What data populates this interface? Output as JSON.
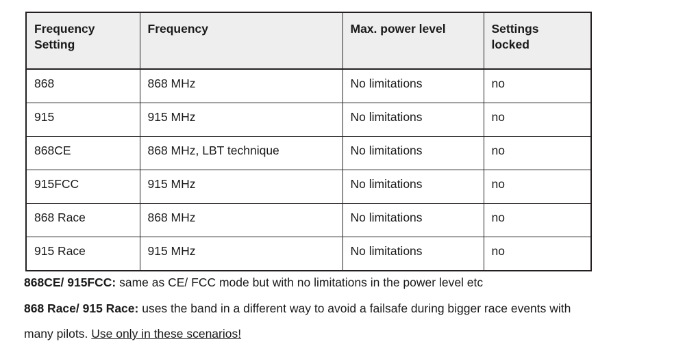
{
  "table": {
    "headers": [
      {
        "line1": "Frequency",
        "line2": "Setting"
      },
      {
        "line1": "Frequency",
        "line2": ""
      },
      {
        "line1": "Max. power level",
        "line2": ""
      },
      {
        "line1": "Settings",
        "line2": "locked"
      }
    ],
    "rows": [
      {
        "setting": "868",
        "frequency": "868 MHz",
        "max_power": "No limitations",
        "locked": "no"
      },
      {
        "setting": "915",
        "frequency": "915 MHz",
        "max_power": "No limitations",
        "locked": "no"
      },
      {
        "setting": "868CE",
        "frequency": "868 MHz, LBT technique",
        "max_power": "No limitations",
        "locked": "no"
      },
      {
        "setting": "915FCC",
        "frequency": "915 MHz",
        "max_power": "No limitations",
        "locked": "no"
      },
      {
        "setting": "868 Race",
        "frequency": "868 MHz",
        "max_power": "No limitations",
        "locked": "no"
      },
      {
        "setting": "915 Race",
        "frequency": "915 MHz",
        "max_power": "No limitations",
        "locked": "no"
      }
    ]
  },
  "notes": {
    "note1": {
      "lead": "868CE/ 915FCC:",
      "rest": " same as CE/ FCC mode but with no limitations in the power level etc"
    },
    "note2": {
      "lead": "868 Race/ 915 Race:",
      "rest": " uses the band in a different way to avoid a failsafe during bigger race events with"
    },
    "note3": {
      "plain": "many pilots. ",
      "underlined": "Use only in these scenarios!"
    }
  },
  "colors": {
    "header_background": "#eeeeee",
    "border": "#231f20",
    "text": "#1a1a1a",
    "page_background": "#ffffff"
  }
}
